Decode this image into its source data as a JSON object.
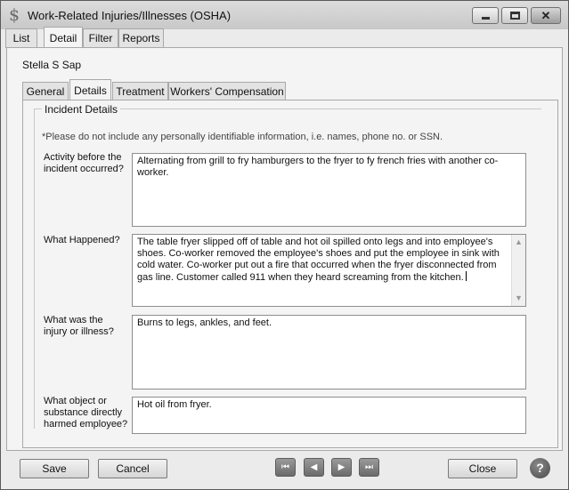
{
  "window": {
    "title": "Work-Related Injuries/Illnesses (OSHA)",
    "app_icon": "dollar-sign-icon",
    "controls": {
      "minimize": "minimize-icon",
      "maximize": "maximize-icon",
      "close": "close-icon",
      "close_glyph": "✕"
    }
  },
  "tabs": [
    {
      "label": "List",
      "active": false
    },
    {
      "label": "Detail",
      "active": true
    },
    {
      "label": "Filter",
      "active": false
    },
    {
      "label": "Reports",
      "active": false
    }
  ],
  "employee_name": "Stella S Sap",
  "subtabs": [
    {
      "label": "General",
      "active": false
    },
    {
      "label": "Details",
      "active": true
    },
    {
      "label": "Treatment",
      "active": false
    },
    {
      "label": "Workers' Compensation",
      "active": false
    }
  ],
  "incident": {
    "group_title": "Incident Details",
    "notice": "*Please do not include any personally identifiable information, i.e. names, phone no. or SSN.",
    "questions": [
      {
        "label": "Activity before the incident occurred?",
        "value": "Alternating from grill to fry hamburgers to the fryer to fy french fries with another co-worker."
      },
      {
        "label": "What Happened?",
        "value": "The table fryer slipped off of table and hot oil spilled onto legs and into employee's shoes. Co-worker removed the employee's shoes and put the employee in sink with cold water. Co-worker put out a fire that occurred when the fryer disconnected from gas line. Customer called 911 when they heard screaming from the kitchen."
      },
      {
        "label": "What was the injury or illness?",
        "value": "Burns to legs, ankles, and feet."
      },
      {
        "label": "What object or substance directly harmed employee?",
        "value": "Hot oil from fryer."
      }
    ]
  },
  "footer": {
    "save_label": "Save",
    "cancel_label": "Cancel",
    "close_label": "Close",
    "nav": {
      "first": "⏮",
      "prev": "◀",
      "next": "▶",
      "last": "⏭"
    },
    "help_label": "?"
  }
}
